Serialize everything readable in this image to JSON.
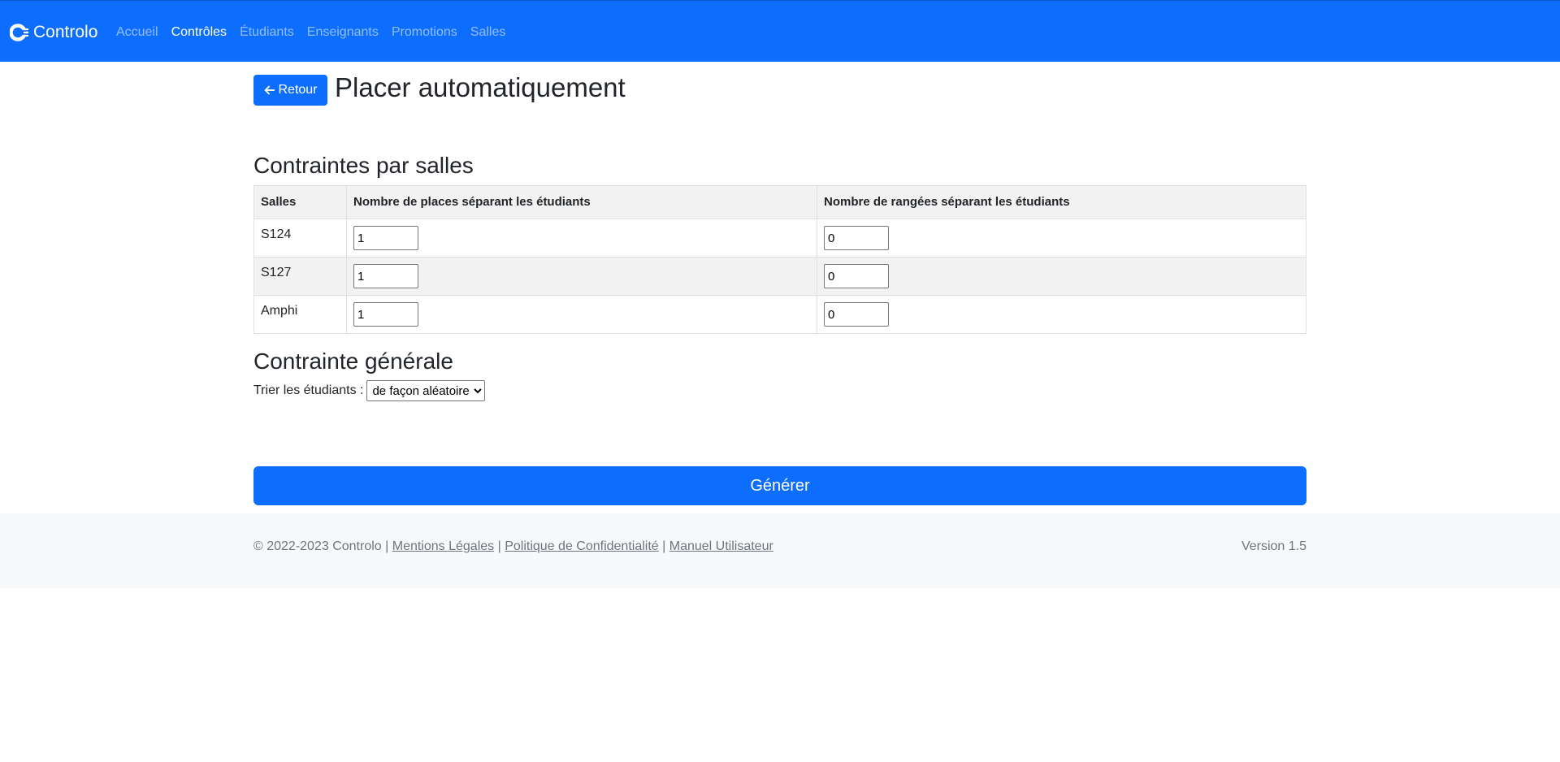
{
  "navbar": {
    "brand": "Controlo",
    "brand_icon": "controlo-logo-icon",
    "items": [
      {
        "label": "Accueil",
        "active": false
      },
      {
        "label": "Contrôles",
        "active": true
      },
      {
        "label": "Étudiants",
        "active": false
      },
      {
        "label": "Enseignants",
        "active": false
      },
      {
        "label": "Promotions",
        "active": false
      },
      {
        "label": "Salles",
        "active": false
      }
    ]
  },
  "header": {
    "back_label": "Retour",
    "back_icon": "arrow-left-icon",
    "title": "Placer automatiquement"
  },
  "contraintes_salles": {
    "title": "Contraintes par salles",
    "columns": [
      "Salles",
      "Nombre de places séparant les étudiants",
      "Nombre de rangées séparant les étudiants"
    ],
    "rows": [
      {
        "salle": "S124",
        "places": "1",
        "rangees": "0"
      },
      {
        "salle": "S127",
        "places": "1",
        "rangees": "0"
      },
      {
        "salle": "Amphi",
        "places": "1",
        "rangees": "0"
      }
    ]
  },
  "contrainte_generale": {
    "title": "Contrainte générale",
    "tri_label": "Trier les étudiants :",
    "tri_selected": "de façon aléatoire"
  },
  "generate_label": "Générer",
  "footer": {
    "copyright": "© 2022-2023 Controlo",
    "separator": "|",
    "links": [
      "Mentions Légales",
      "Politique de Confidentialité",
      "Manuel Utilisateur"
    ],
    "version": "Version 1.5"
  },
  "colors": {
    "primary": "#0d6efd",
    "footer_bg": "#f8f9fa",
    "muted_text": "#6c757d",
    "table_stripe": "#f2f2f2"
  }
}
